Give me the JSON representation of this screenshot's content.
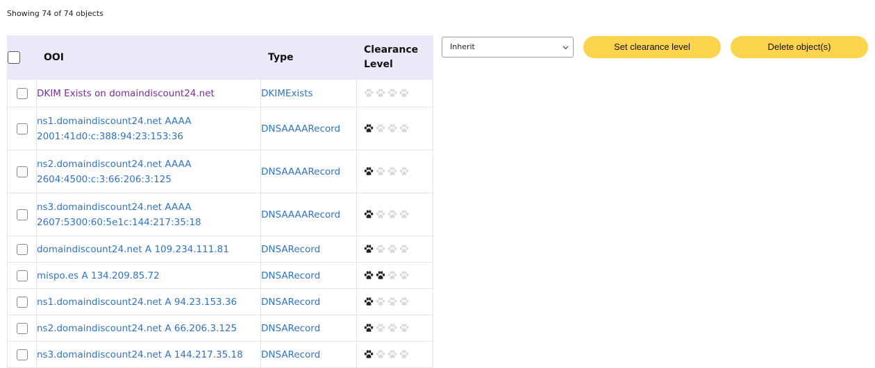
{
  "summary": "Showing 74 of 74 objects",
  "table": {
    "headers": {
      "ooi": "OOI",
      "type": "Type",
      "clearance_line1": "Clearance",
      "clearance_line2": "Level"
    },
    "rows": [
      {
        "ooi_line1": "DKIM Exists on domaindiscount24.net",
        "ooi_line2": "",
        "type": "DKIMExists",
        "level": 0,
        "visited": true
      },
      {
        "ooi_line1": "ns1.domaindiscount24.net AAAA",
        "ooi_line2": "2001:41d0:c:388:94:23:153:36",
        "type": "DNSAAAARecord",
        "level": 1,
        "visited": false
      },
      {
        "ooi_line1": "ns2.domaindiscount24.net AAAA",
        "ooi_line2": "2604:4500:c:3:66:206:3:125",
        "type": "DNSAAAARecord",
        "level": 1,
        "visited": false
      },
      {
        "ooi_line1": "ns3.domaindiscount24.net AAAA",
        "ooi_line2": "2607:5300:60:5e1c:144:217:35:18",
        "type": "DNSAAAARecord",
        "level": 1,
        "visited": false
      },
      {
        "ooi_line1": "domaindiscount24.net A 109.234.111.81",
        "ooi_line2": "",
        "type": "DNSARecord",
        "level": 1,
        "visited": false
      },
      {
        "ooi_line1": "mispo.es A 134.209.85.72",
        "ooi_line2": "",
        "type": "DNSARecord",
        "level": 2,
        "visited": false
      },
      {
        "ooi_line1": "ns1.domaindiscount24.net A 94.23.153.36",
        "ooi_line2": "",
        "type": "DNSARecord",
        "level": 1,
        "visited": false
      },
      {
        "ooi_line1": "ns2.domaindiscount24.net A 66.206.3.125",
        "ooi_line2": "",
        "type": "DNSARecord",
        "level": 1,
        "visited": false
      },
      {
        "ooi_line1": "ns3.domaindiscount24.net A 144.217.35.18",
        "ooi_line2": "",
        "type": "DNSARecord",
        "level": 1,
        "visited": false
      }
    ]
  },
  "controls": {
    "clearance_select_value": "Inherit",
    "set_clearance_label": "Set clearance level",
    "delete_label": "Delete object(s)"
  },
  "colors": {
    "button": "#fcd34d",
    "header_bg": "#ece8f7",
    "link": "#2f73c4",
    "visited_link": "#7a2aa2"
  },
  "icons": {
    "level_icon": "paw-icon",
    "select_icon": "chevron-down-icon"
  }
}
